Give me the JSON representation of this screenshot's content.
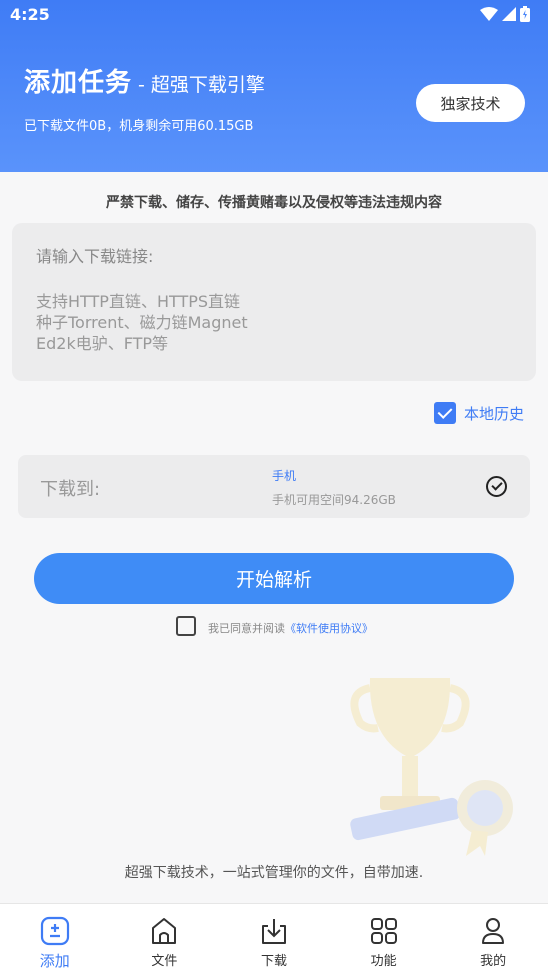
{
  "status_bar": {
    "time": "4:25"
  },
  "header": {
    "title": "添加任务",
    "subtitle": "- 超强下载引擎",
    "storage": "已下载文件0B，机身剩余可用60.15GB",
    "exclusive_button": "独家技术"
  },
  "warning": "严禁下载、储存、传播黄赌毒以及侵权等违法违规内容",
  "link_input": {
    "label": "请输入下载链接:",
    "hint": "支持HTTP直链、HTTPS直链\n种子Torrent、磁力链Magnet\nEd2k电驴、FTP等"
  },
  "history": {
    "label": "本地历史",
    "checked": true
  },
  "destination": {
    "label": "下载到:",
    "name": "手机",
    "space": "手机可用空间94.26GB"
  },
  "parse_button": "开始解析",
  "agreement": {
    "text": "我已同意并阅读",
    "link": "《软件使用协议》",
    "checked": false
  },
  "footer_text": "超强下载技术，一站式管理你的文件，自带加速.",
  "nav": [
    {
      "label": "添加",
      "icon": "add-icon",
      "active": true
    },
    {
      "label": "文件",
      "icon": "home-icon",
      "active": false
    },
    {
      "label": "下载",
      "icon": "download-icon",
      "active": false
    },
    {
      "label": "功能",
      "icon": "grid-icon",
      "active": false
    },
    {
      "label": "我的",
      "icon": "profile-icon",
      "active": false
    }
  ],
  "colors": {
    "accent": "#3f7cf5",
    "button": "#3f8cf6"
  }
}
